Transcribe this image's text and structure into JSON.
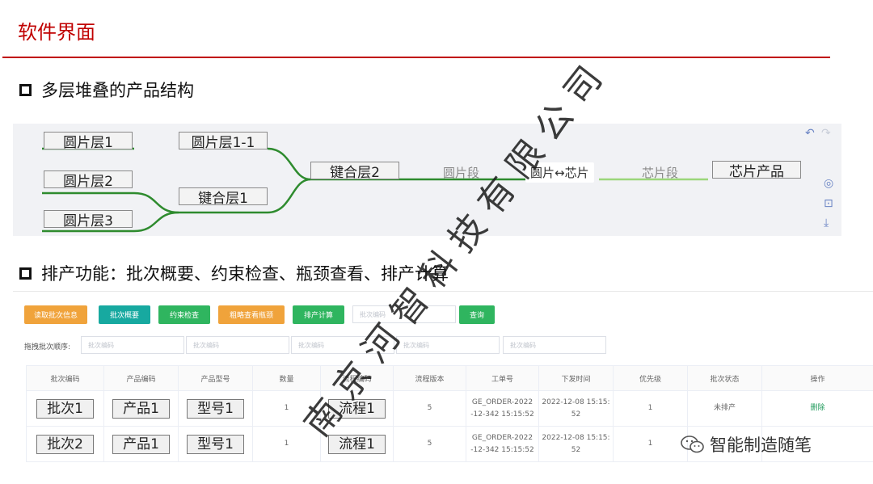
{
  "slide": {
    "title": "软件界面"
  },
  "sections": {
    "structure": "多层堆叠的产品结构",
    "scheduling": "排产功能：批次概要、约束检查、瓶颈查看、排产计算"
  },
  "mindmap": {
    "nodes": {
      "wafer1": "圆片层1",
      "wafer1_1": "圆片层1-1",
      "wafer2": "圆片层2",
      "wafer3": "圆片层3",
      "bond1": "键合层1",
      "bond2": "键合层2",
      "wafer_seg": "圆片段",
      "center": "圆片↔芯片",
      "chip_seg": "芯片段",
      "chip_product": "芯片产品"
    },
    "tools": {
      "undo": "↶",
      "redo": "↷",
      "locate": "◎",
      "fit": "⊡",
      "download": "⤓"
    },
    "colors": {
      "link": "#2e8b2e",
      "link_light": "#9bd67a"
    }
  },
  "schedule": {
    "buttons": [
      {
        "label": "读取批次信息",
        "color": "#f0a33b"
      },
      {
        "label": "批次概要",
        "color": "#17a9a0"
      },
      {
        "label": "约束检查",
        "color": "#2fb55f"
      },
      {
        "label": "粗略查看瓶颈",
        "color": "#f0a33b"
      },
      {
        "label": "排产计算",
        "color": "#2fb55f"
      }
    ],
    "search_placeholder": "批次编码",
    "query_label": "查询",
    "drag_label": "拖拽批次顺序:",
    "order_placeholders": [
      "批次编码",
      "批次编码",
      "批次编码",
      "批次编码",
      "批次编码"
    ],
    "columns": [
      "批次编码",
      "产品编码",
      "产品型号",
      "数量",
      "流程编码",
      "流程版本",
      "工单号",
      "下发时间",
      "优先级",
      "批次状态",
      "操作"
    ],
    "rows": [
      {
        "batch": "批次1",
        "product": "产品1",
        "model": "型号1",
        "qty": "1",
        "process": "流程1",
        "version": "5",
        "order_l1": "GE_ORDER-2022",
        "order_l2": "-12-342 15:15:52",
        "time_l1": "2022-12-08 15:15:",
        "time_l2": "52",
        "priority": "1",
        "status": "未排产",
        "action": "删除"
      },
      {
        "batch": "批次2",
        "product": "产品1",
        "model": "型号1",
        "qty": "1",
        "process": "流程1",
        "version": "5",
        "order_l1": "GE_ORDER-2022",
        "order_l2": "-12-342 15:15:52",
        "time_l1": "2022-12-08 15:15:",
        "time_l2": "52",
        "priority": "1",
        "status": "",
        "action": ""
      }
    ]
  },
  "watermark": "南京河智科技有限公司",
  "signature": "智能制造随笔"
}
